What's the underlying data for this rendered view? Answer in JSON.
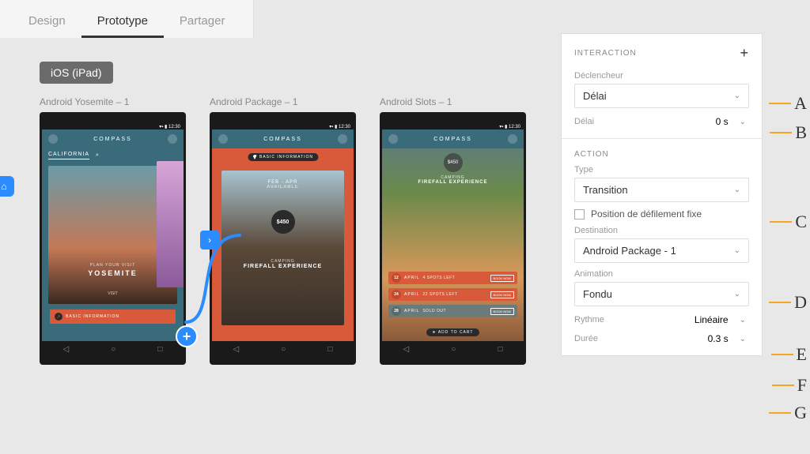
{
  "tabs": {
    "design": "Design",
    "prototype": "Prototype",
    "share": "Partager"
  },
  "device_badge": "iOS (iPad)",
  "artboards": [
    {
      "label": "Android Yosemite – 1",
      "app_title": "COMPASS",
      "subheader": "CALIFORNIA",
      "hero_small": "PLAN YOUR VISIT",
      "hero_big": "YOSEMITE",
      "hero_visit": "VISIT",
      "info_bar": "BASIC INFORMATION"
    },
    {
      "label": "Android Package – 1",
      "app_title": "COMPASS",
      "pill": "BASIC INFORMATION",
      "dates": "FEB - APR",
      "available": "AVAILABLE",
      "price": "$450",
      "camping": "CAMPING",
      "firefall": "FIREFALL EXPERIENCE"
    },
    {
      "label": "Android Slots – 1",
      "app_title": "COMPASS",
      "price": "$450",
      "camping": "CAMPING",
      "firefall": "FIREFALL EXPERIENCE",
      "slots": [
        {
          "day": "12",
          "month": "APRIL",
          "spots": "4 SPOTS LEFT",
          "cta": "BOOK NOW"
        },
        {
          "day": "24",
          "month": "APRIL",
          "spots": "22 SPOTS LEFT",
          "cta": "BOOK NOW"
        },
        {
          "day": "28",
          "month": "APRIL",
          "spots": "SOLD OUT",
          "cta": "BOOK NOW"
        }
      ],
      "add_cart": "➤ ADD TO CART"
    }
  ],
  "panel": {
    "interaction_header": "INTERACTION",
    "trigger_label": "Déclencheur",
    "trigger_value": "Délai",
    "delay_label": "Délai",
    "delay_value": "0 s",
    "action_header": "ACTION",
    "type_label": "Type",
    "type_value": "Transition",
    "fixed_scroll": "Position de défilement fixe",
    "destination_label": "Destination",
    "destination_value": "Android Package - 1",
    "animation_label": "Animation",
    "animation_value": "Fondu",
    "easing_label": "Rythme",
    "easing_value": "Linéaire",
    "duration_label": "Durée",
    "duration_value": "0.3 s"
  },
  "annotations": {
    "A": "A",
    "B": "B",
    "C": "C",
    "D": "D",
    "E": "E",
    "F": "F",
    "G": "G"
  }
}
